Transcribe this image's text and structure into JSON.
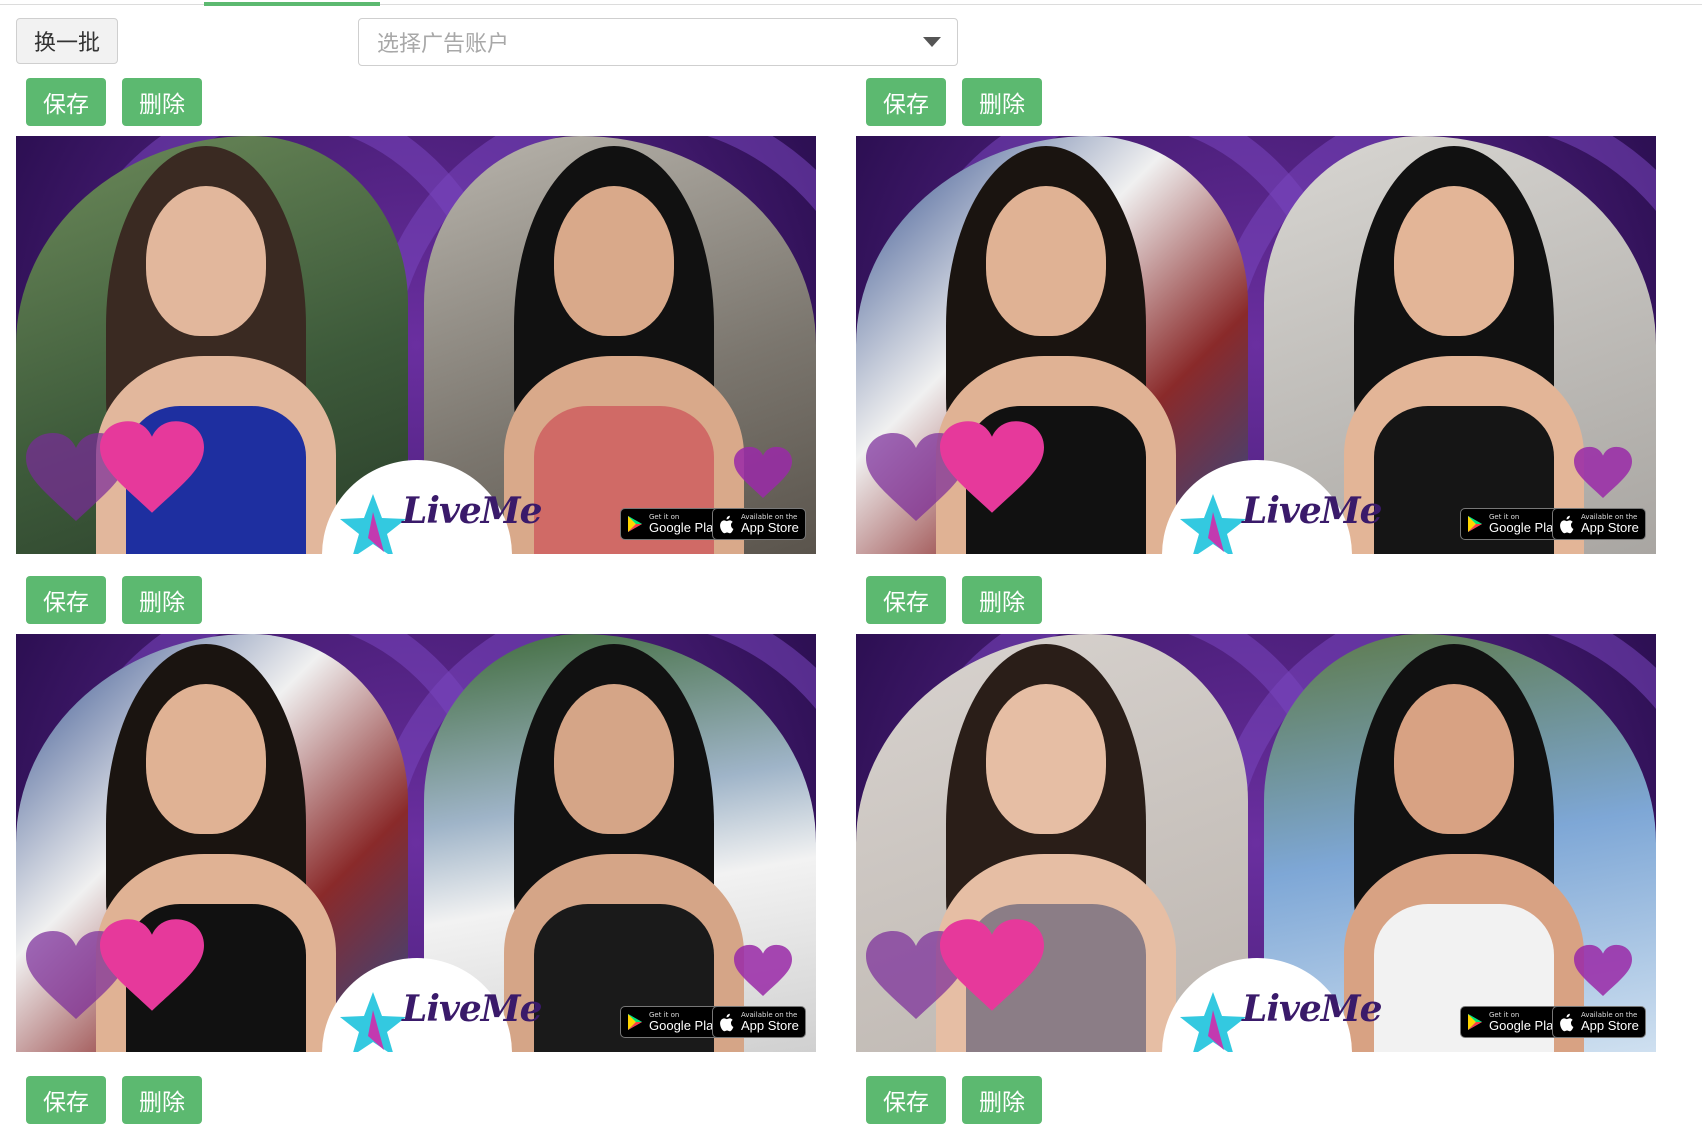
{
  "toolbar": {
    "refresh_label": "换一批",
    "account_select_placeholder": "选择广告账户"
  },
  "actions": {
    "save_label": "保存",
    "delete_label": "删除"
  },
  "creatives": [
    {
      "brand": "LiveMe",
      "google_badge_small": "Get it on",
      "google_badge_big": "Google Play",
      "apple_badge_small": "Available on the",
      "apple_badge_big": "App Store"
    },
    {
      "brand": "LiveMe",
      "google_badge_small": "Get it on",
      "google_badge_big": "Google Play",
      "apple_badge_small": "Available on the",
      "apple_badge_big": "App Store"
    },
    {
      "brand": "LiveMe",
      "google_badge_small": "Get it on",
      "google_badge_big": "Google Play",
      "apple_badge_small": "Available on the",
      "apple_badge_big": "App Store"
    },
    {
      "brand": "LiveMe",
      "google_badge_small": "Get it on",
      "google_badge_big": "Google Play",
      "apple_badge_small": "Available on the",
      "apple_badge_big": "App Store"
    }
  ],
  "colors": {
    "primary_green": "#5cb970",
    "creative_purple": "#4a1e78",
    "heart_pink": "#e6399b"
  }
}
